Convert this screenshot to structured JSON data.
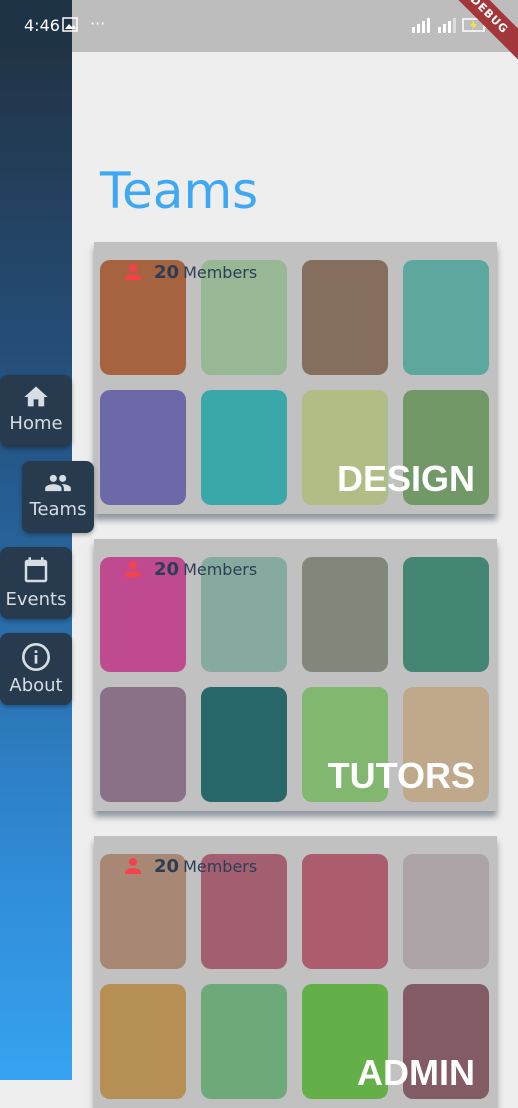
{
  "status_bar": {
    "time": "4:46",
    "dots": "···",
    "debug": "DEBUG"
  },
  "nav": [
    {
      "label": "Home",
      "icon": "home-icon"
    },
    {
      "label": "Teams",
      "icon": "people-icon",
      "selected": true
    },
    {
      "label": "Events",
      "icon": "calendar-icon"
    },
    {
      "label": "About",
      "icon": "info-icon"
    }
  ],
  "page": {
    "title": "Teams"
  },
  "members_label": "Members",
  "teams": [
    {
      "name": "DESIGN",
      "members": "20",
      "colors": [
        "#a5633f",
        "#98b794",
        "#866e5e",
        "#5da79f",
        "#6d69a8",
        "#3aa7a8",
        "#b0be85",
        "#729868"
      ]
    },
    {
      "name": "TUTORS",
      "members": "20",
      "colors": [
        "#c04a90",
        "#86aaa0",
        "#81877a",
        "#458573",
        "#8a7187",
        "#28686a",
        "#82b76f",
        "#c0a98b"
      ]
    },
    {
      "name": "ADMIN",
      "members": "20",
      "colors": [
        "#a88875",
        "#a35e70",
        "#ac5d6d",
        "#aca3a6",
        "#b68f54",
        "#6ea979",
        "#64b048",
        "#835b64"
      ]
    }
  ],
  "colors": {
    "accent": "#3ea8f2",
    "nav_bg": "#273a4e",
    "member_icon": "#f4414b"
  }
}
